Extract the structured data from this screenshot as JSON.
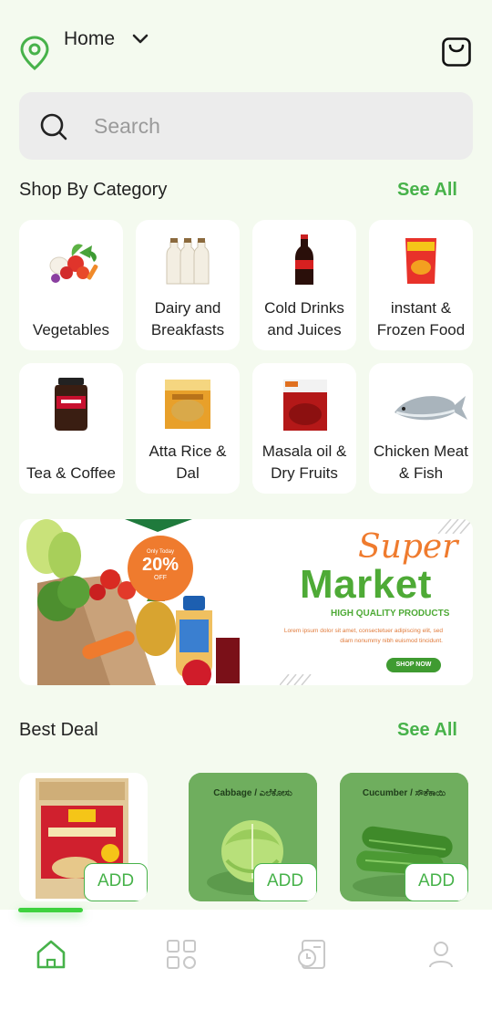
{
  "header": {
    "location_label": "Home"
  },
  "search": {
    "placeholder": "Search"
  },
  "categories_section": {
    "title": "Shop By Category",
    "see_all": "See All",
    "items": [
      {
        "label": "Vegetables",
        "icon": "vegetables-icon"
      },
      {
        "label": "Dairy and Breakfasts",
        "icon": "milk-bottles-icon"
      },
      {
        "label": "Cold Drinks and Juices",
        "icon": "cola-bottle-icon"
      },
      {
        "label": "instant & Frozen Food",
        "icon": "snack-packet-icon"
      },
      {
        "label": "Tea & Coffee",
        "icon": "coffee-jar-icon"
      },
      {
        "label": "Atta Rice & Dal",
        "icon": "flour-bag-icon"
      },
      {
        "label": "Masala oil & Dry Fruits",
        "icon": "chili-powder-icon"
      },
      {
        "label": "Chicken Meat & Fish",
        "icon": "fish-icon"
      }
    ]
  },
  "banner": {
    "badge_top": "Only Today",
    "badge_percent": "20%",
    "badge_bottom": "OFF",
    "super": "Super",
    "market": "Market",
    "tagline": "HIGH QUALITY PRODUCTS",
    "lorem": "Lorem ipsum dolor sit amet, consectetuer adipiscing elit, sed diam nonummy nibh euismod tincidunt.",
    "cta": "SHOP NOW"
  },
  "best_deal": {
    "title": "Best Deal",
    "see_all": "See All",
    "items": [
      {
        "name": "",
        "add_label": "ADD",
        "icon": "atta-packet-icon"
      },
      {
        "name": "Cabbage / ಎಲೆಕೋಸು",
        "add_label": "ADD",
        "icon": "cabbage-icon"
      },
      {
        "name": "Cucumber / ಸೌತೆಕಾಯಿ",
        "add_label": "ADD",
        "icon": "cucumber-icon"
      }
    ]
  },
  "bottom_nav": {
    "items": [
      "home-icon",
      "categories-icon",
      "orders-icon",
      "profile-icon"
    ],
    "active_index": 0
  },
  "colors": {
    "accent": "#47b24a",
    "background": "#f4faef",
    "banner_orange": "#ef7b2e",
    "banner_green": "#4eaa36"
  }
}
